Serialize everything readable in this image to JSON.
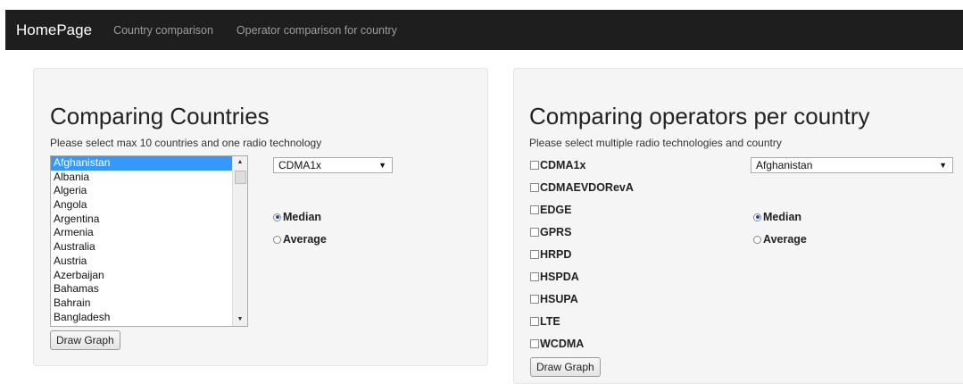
{
  "navbar": {
    "brand": "HomePage",
    "links": [
      "Country comparison",
      "Operator comparison for country"
    ]
  },
  "left": {
    "title": "Comparing Countries",
    "description": "Please select max 10 countries and one radio technology",
    "countries": [
      "Afghanistan",
      "Albania",
      "Algeria",
      "Angola",
      "Argentina",
      "Armenia",
      "Australia",
      "Austria",
      "Azerbaijan",
      "Bahamas",
      "Bahrain",
      "Bangladesh"
    ],
    "selected_country": "Afghanistan",
    "technology_value": "CDMA1x",
    "radio_options": [
      {
        "label": "Median",
        "checked": true
      },
      {
        "label": "Average",
        "checked": false
      }
    ],
    "button": "Draw Graph"
  },
  "right": {
    "title": "Comparing operators per country",
    "description": "Please select multiple radio technologies and country",
    "technologies": [
      "CDMA1x",
      "CDMAEVDORevA",
      "EDGE",
      "GPRS",
      "HRPD",
      "HSPDA",
      "HSUPA",
      "LTE",
      "WCDMA"
    ],
    "country_value": "Afghanistan",
    "radio_options": [
      {
        "label": "Median",
        "checked": true
      },
      {
        "label": "Average",
        "checked": false
      }
    ],
    "button": "Draw Graph"
  }
}
